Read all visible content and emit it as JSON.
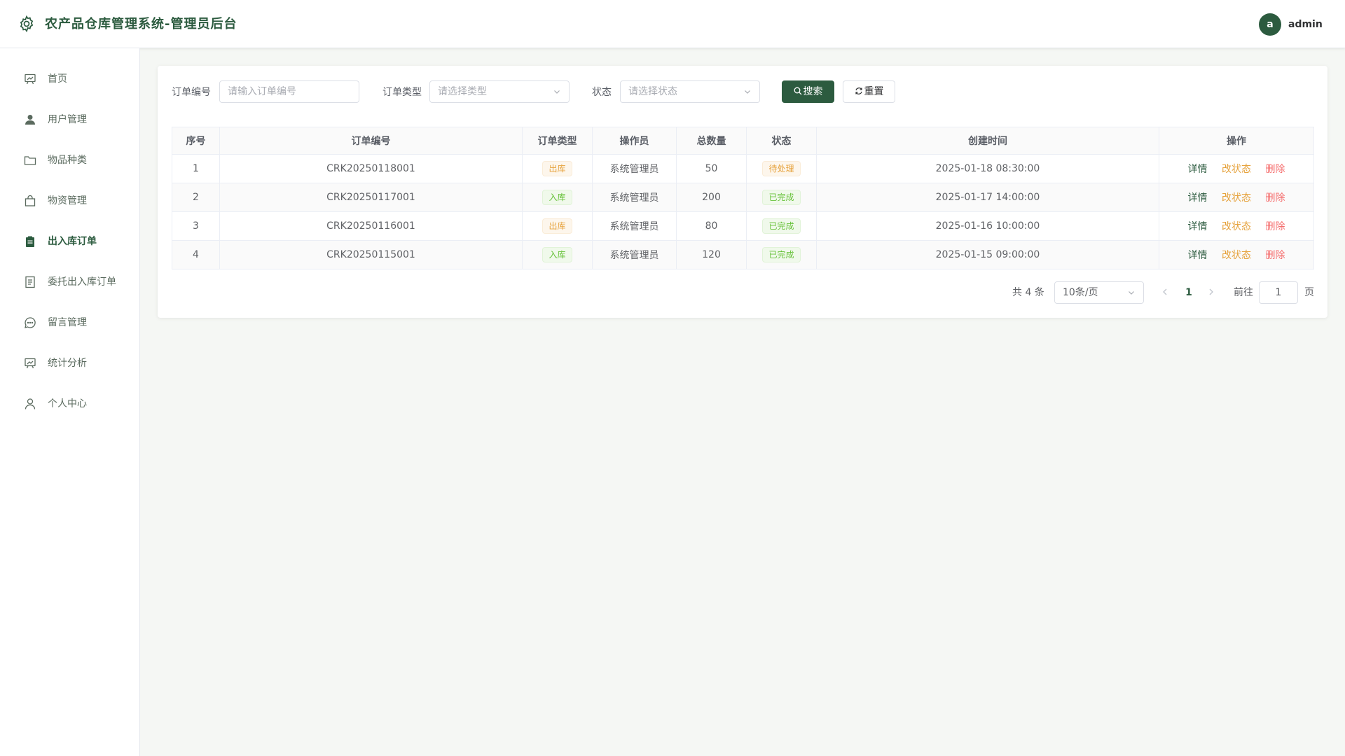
{
  "header": {
    "title": "农产品仓库管理系统-管理员后台",
    "avatar_letter": "a",
    "username": "admin",
    "icon": "gear-icon"
  },
  "sidebar": {
    "items": [
      {
        "label": "首页",
        "icon": "dashboard-icon",
        "active": false
      },
      {
        "label": "用户管理",
        "icon": "user-icon",
        "active": false
      },
      {
        "label": "物品种类",
        "icon": "folder-icon",
        "active": false
      },
      {
        "label": "物资管理",
        "icon": "shopping-bag-icon",
        "active": false
      },
      {
        "label": "出入库订单",
        "icon": "clipboard-icon",
        "active": true
      },
      {
        "label": "委托出入库订单",
        "icon": "document-icon",
        "active": false
      },
      {
        "label": "留言管理",
        "icon": "chat-icon",
        "active": false
      },
      {
        "label": "统计分析",
        "icon": "chart-icon",
        "active": false
      },
      {
        "label": "个人中心",
        "icon": "person-icon",
        "active": false
      }
    ]
  },
  "filters": {
    "order_no_label": "订单编号",
    "order_no_placeholder": "请输入订单编号",
    "order_type_label": "订单类型",
    "order_type_placeholder": "请选择类型",
    "status_label": "状态",
    "status_placeholder": "请选择状态",
    "search_label": "搜索",
    "reset_label": "重置"
  },
  "table": {
    "headers": [
      "序号",
      "订单编号",
      "订单类型",
      "操作员",
      "总数量",
      "状态",
      "创建时间",
      "操作"
    ],
    "rows": [
      {
        "index": "1",
        "order_no": "CRK20250118001",
        "type": "出库",
        "operator": "系统管理员",
        "quantity": "50",
        "status": "待处理",
        "created": "2025-01-18 08:30:00"
      },
      {
        "index": "2",
        "order_no": "CRK20250117001",
        "type": "入库",
        "operator": "系统管理员",
        "quantity": "200",
        "status": "已完成",
        "created": "2025-01-17 14:00:00"
      },
      {
        "index": "3",
        "order_no": "CRK20250116001",
        "type": "出库",
        "operator": "系统管理员",
        "quantity": "80",
        "status": "已完成",
        "created": "2025-01-16 10:00:00"
      },
      {
        "index": "4",
        "order_no": "CRK20250115001",
        "type": "入库",
        "operator": "系统管理员",
        "quantity": "120",
        "status": "已完成",
        "created": "2025-01-15 09:00:00"
      }
    ],
    "actions": {
      "detail": "详情",
      "change_status": "改状态",
      "delete": "删除"
    }
  },
  "pagination": {
    "total_text": "共 4 条",
    "page_size": "10条/页",
    "current_page": "1",
    "goto_label": "前往",
    "goto_value": "1",
    "page_unit": "页"
  },
  "colors": {
    "brand": "#2c5b3f",
    "warning": "#e6a23c",
    "success": "#67c23a",
    "danger": "#f56c6c"
  }
}
